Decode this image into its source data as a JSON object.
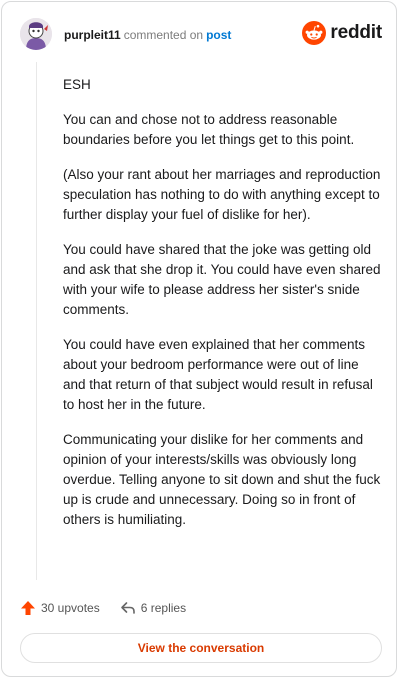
{
  "header": {
    "username": "purpleit11",
    "verb": "commented on",
    "post_link": "post",
    "brand": "reddit",
    "avatar_icon": "snoo-avatar-icon",
    "brand_color": "#ff4500"
  },
  "comment": {
    "paragraphs": [
      "ESH",
      "You can and chose not to address reasonable boundaries before you let things get to this point.",
      "(Also your rant about her marriages and reproduction speculation has nothing to do with anything except to further display your fuel of dislike for her).",
      "You could have shared that the joke was getting old and ask that she drop it. You could have even shared with your wife to please address her sister's snide comments.",
      "You could have even explained that her comments about your bedroom performance were out of line and that return of that subject would result in refusal to host her in the future.",
      "Communicating your dislike for her comments and opinion of your interests/skills was obviously long overdue. Telling anyone to sit down and shut the fuck up is crude and unnecessary. Doing so in front of others is humiliating."
    ]
  },
  "actions": {
    "upvotes": "30 upvotes",
    "replies": "6 replies"
  },
  "cta": {
    "label": "View the conversation"
  }
}
